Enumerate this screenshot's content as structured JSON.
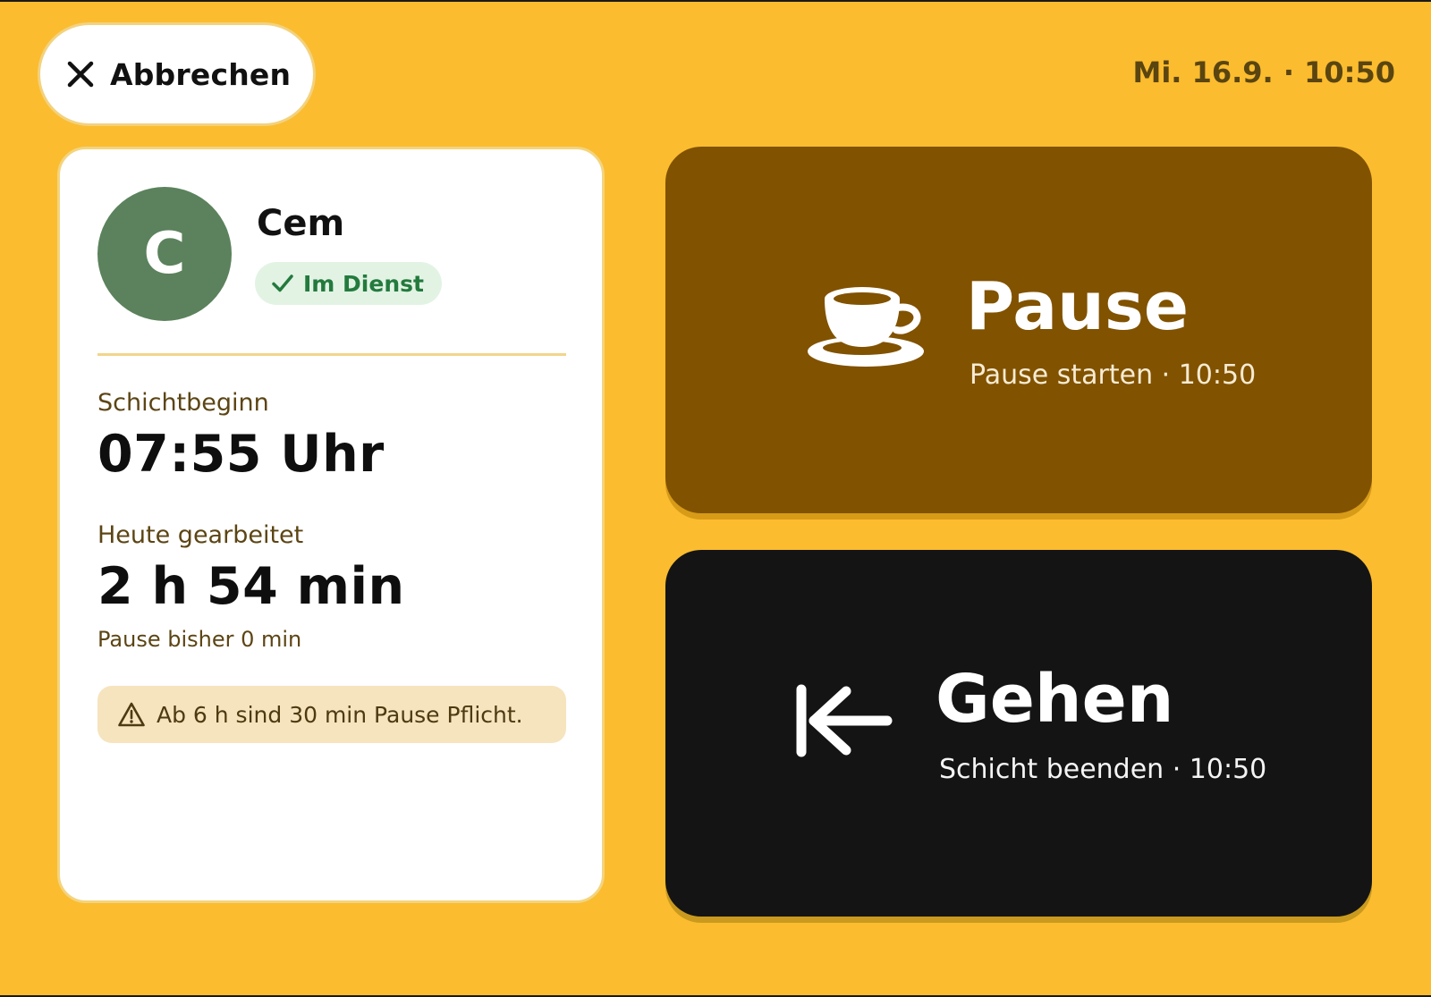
{
  "header": {
    "cancel_label": "Abbrechen",
    "datetime": "Mi. 16.9. · 10:50"
  },
  "employee": {
    "initial": "C",
    "name": "Cem",
    "status": "Im Dienst"
  },
  "shift": {
    "start_label": "Schichtbeginn",
    "start_value": "07:55 Uhr",
    "worked_label": "Heute gearbeitet",
    "worked_value": "2 h 54 min",
    "break_note": "Pause bisher 0 min",
    "warning": "Ab 6 h sind 30 min Pause Pflicht."
  },
  "actions": {
    "pause": {
      "title": "Pause",
      "subtitle": "Pause starten · 10:50",
      "icon": "coffee-cup-icon"
    },
    "leave": {
      "title": "Gehen",
      "subtitle": "Schicht beenden · 10:50",
      "icon": "arrow-left-exit-icon"
    }
  },
  "colors": {
    "background": "#FBBC2F",
    "avatar": "#5B825C",
    "status_badge": "#E2F3E4",
    "status_text": "#237A3D",
    "pause_button": "#815200",
    "leave_button": "#141414",
    "warning_box": "#F6E4BE"
  }
}
